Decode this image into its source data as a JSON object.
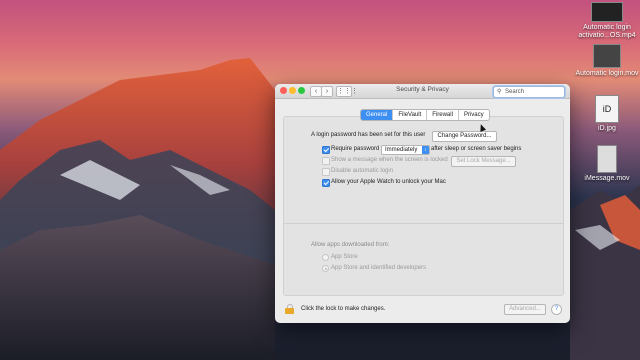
{
  "window": {
    "title": "Security & Privacy",
    "search_placeholder": "Search"
  },
  "tabs": [
    {
      "label": "General",
      "active": true
    },
    {
      "label": "FileVault",
      "active": false
    },
    {
      "label": "Firewall",
      "active": false
    },
    {
      "label": "Privacy",
      "active": false
    }
  ],
  "general": {
    "login_password_text": "A login password has been set for this user",
    "change_password_label": "Change Password...",
    "require_password_label": "Require password",
    "require_password_value": "Immediately",
    "after_sleep_text": "after sleep or screen saver begins",
    "show_message_label": "Show a message when the screen is locked",
    "set_lock_message_label": "Set Lock Message...",
    "disable_auto_login_label": "Disable automatic login",
    "apple_watch_label": "Allow your Apple Watch to unlock your Mac"
  },
  "downloads": {
    "heading": "Allow apps downloaded from:",
    "options": [
      {
        "label": "App Store",
        "selected": false
      },
      {
        "label": "App Store and identified developers",
        "selected": true
      }
    ]
  },
  "footer": {
    "lock_text": "Click the lock to make changes.",
    "advanced_label": "Advanced...",
    "help_label": "?"
  },
  "desktop": [
    {
      "label": "Automatic login activatio...OS.mp4"
    },
    {
      "label": "Automatic login.mov"
    },
    {
      "label": "iD.jpg",
      "thumb_text": "iD"
    },
    {
      "label": "iMessage.mov"
    }
  ],
  "colors": {
    "accent": "#3d8ff1",
    "lock": "#e8a92a"
  }
}
